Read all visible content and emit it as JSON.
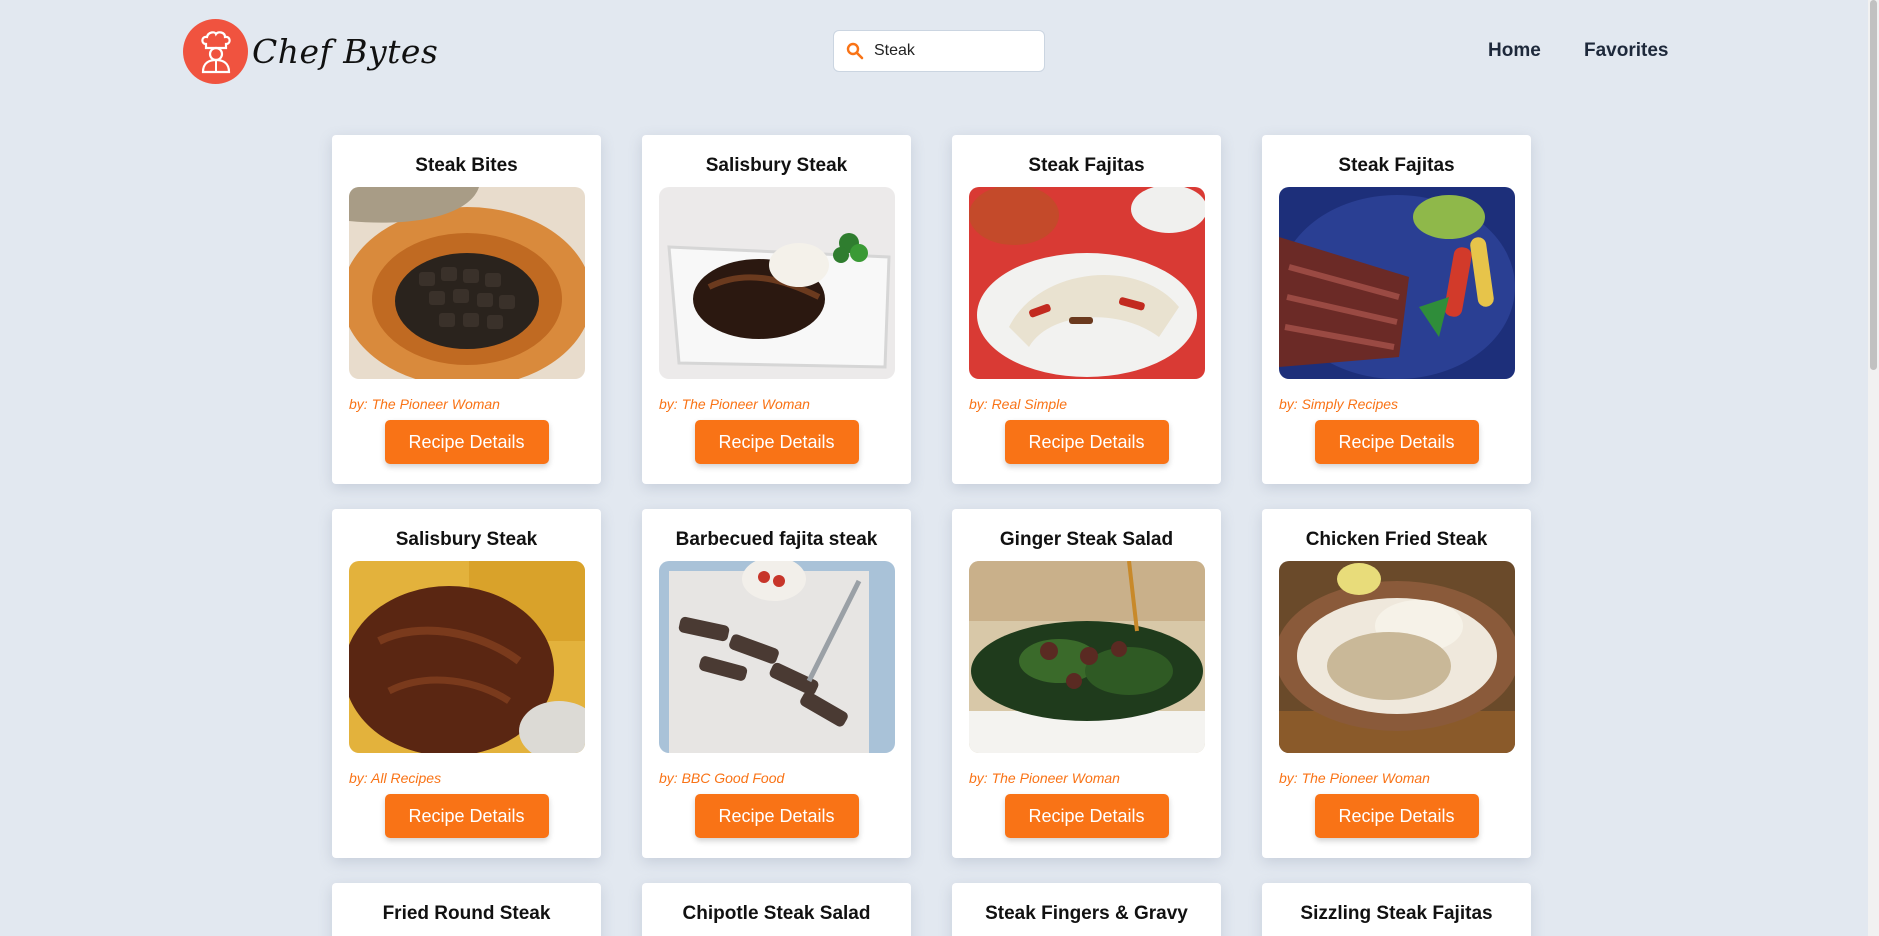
{
  "header": {
    "brand": "Chef Bytes",
    "search": {
      "value": "Steak",
      "placeholder": ""
    },
    "nav": [
      {
        "label": "Home"
      },
      {
        "label": "Favorites"
      }
    ]
  },
  "colors": {
    "accent": "#f97316",
    "logo": "#f0533f",
    "background": "#e2e8f0"
  },
  "recipes": [
    {
      "title": "Steak Bites",
      "author": "by: The Pioneer Woman",
      "button": "Recipe Details",
      "image": "steak-bites-photo"
    },
    {
      "title": "Salisbury Steak",
      "author": "by: The Pioneer Woman",
      "button": "Recipe Details",
      "image": "salisbury-steak-photo"
    },
    {
      "title": "Steak Fajitas",
      "author": "by: Real Simple",
      "button": "Recipe Details",
      "image": "steak-fajitas-photo"
    },
    {
      "title": "Steak Fajitas",
      "author": "by: Simply Recipes",
      "button": "Recipe Details",
      "image": "steak-fajitas-photo"
    },
    {
      "title": "Salisbury Steak",
      "author": "by: All Recipes",
      "button": "Recipe Details",
      "image": "salisbury-steak-photo"
    },
    {
      "title": "Barbecued fajita steak",
      "author": "by: BBC Good Food",
      "button": "Recipe Details",
      "image": "fajita-steak-photo"
    },
    {
      "title": "Ginger Steak Salad",
      "author": "by: The Pioneer Woman",
      "button": "Recipe Details",
      "image": "steak-salad-photo"
    },
    {
      "title": "Chicken Fried Steak",
      "author": "by: The Pioneer Woman",
      "button": "Recipe Details",
      "image": "chicken-fried-steak-photo"
    },
    {
      "title": "Fried Round Steak"
    },
    {
      "title": "Chipotle Steak Salad"
    },
    {
      "title": "Steak Fingers & Gravy"
    },
    {
      "title": "Sizzling Steak Fajitas"
    }
  ]
}
